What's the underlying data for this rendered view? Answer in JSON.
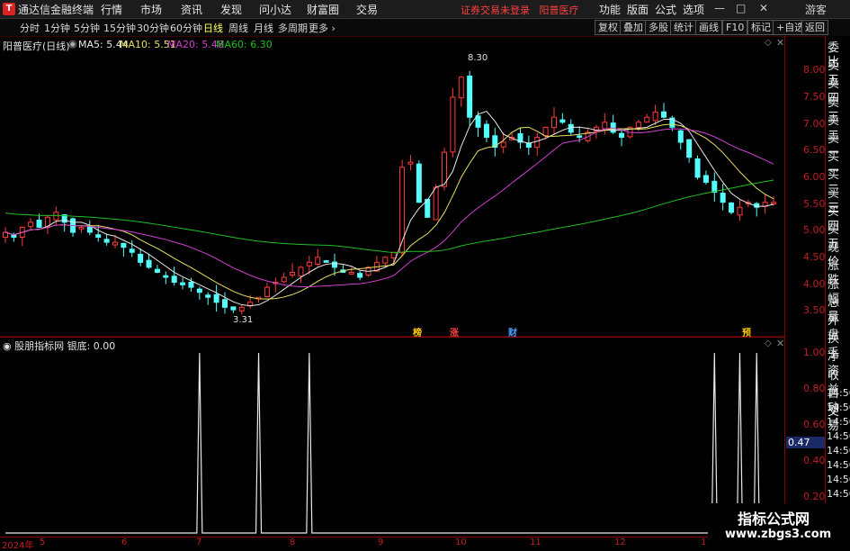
{
  "app": {
    "title": "通达信金融终端",
    "notice": "证券交易未登录",
    "stock_link": "阳普医疗"
  },
  "menu": [
    "行情",
    "市场",
    "资讯",
    "发现",
    "问小达",
    "财富圈",
    "交易"
  ],
  "right_menu": [
    "功能",
    "版面",
    "公式",
    "选项"
  ],
  "window_controls": {
    "min": "—",
    "max": "□",
    "close": "✕",
    "user": "游客"
  },
  "periods": [
    "分时",
    "1分钟",
    "5分钟",
    "15分钟",
    "30分钟",
    "60分钟",
    "日线",
    "周线",
    "月线",
    "多周期",
    "更多"
  ],
  "active_period": "日线",
  "toolbar_buttons": [
    "复权",
    "叠加",
    "多股",
    "统计",
    "画线",
    "F10",
    "标记",
    "+自选",
    "返回"
  ],
  "legend": {
    "name": "阳普医疗(日线)",
    "ma5": "MA5: 5.44",
    "ma10": "MA10: 5.51",
    "ma20": "MA20: 5.48",
    "ma60": "MA60: 6.30"
  },
  "colors": {
    "up": "#ff3b3b",
    "down": "#54ffff",
    "ma5": "#e8e8e8",
    "ma10": "#e8e060",
    "ma20": "#d040d0",
    "ma60": "#20c020",
    "axis": "#c02020"
  },
  "annotations": {
    "high": "8.30",
    "low": "3.31"
  },
  "event_tags": [
    "榜",
    "涨",
    "财",
    "预"
  ],
  "y_ticks": [
    "8.00",
    "7.50",
    "7.00",
    "6.50",
    "6.00",
    "5.50",
    "5.00",
    "4.50",
    "4.00",
    "3.50"
  ],
  "sub": {
    "legend": "股朋指标网  银底: 0.00",
    "y_ticks": [
      "1.00",
      "0.80",
      "0.60",
      "0.40",
      "0.20"
    ],
    "current": "0.47"
  },
  "right_panel": [
    "委比",
    "卖五",
    "卖四",
    "卖三",
    "卖二",
    "卖一",
    "买一",
    "买二",
    "买三",
    "买四",
    "买五",
    "现价",
    "涨跌",
    "涨幅",
    "总量",
    "外盘",
    "换手",
    "净资",
    "收益",
    "自动",
    "交易"
  ],
  "right_times": [
    "14:56",
    "14:56",
    "14:56",
    "14:56",
    "14:56",
    "14:56",
    "14:56",
    "14:56",
    "14:56"
  ],
  "x_ticks": [
    "2024年",
    "5",
    "6",
    "7",
    "8",
    "9",
    "10",
    "11",
    "12",
    "1"
  ],
  "watermark": {
    "line1": "指标公式网",
    "line2": "www.zbgs3.com"
  },
  "chart_data": {
    "type": "line",
    "title": "阳普医疗(日线)",
    "ylim": [
      3.1,
      8.5
    ],
    "close": [
      4.9,
      4.8,
      5.0,
      5.1,
      5.0,
      5.2,
      5.3,
      5.1,
      4.9,
      5.0,
      4.9,
      4.8,
      4.7,
      4.7,
      4.6,
      4.5,
      4.3,
      4.2,
      4.1,
      4.0,
      3.9,
      3.85,
      3.8,
      3.7,
      3.6,
      3.5,
      3.4,
      3.35,
      3.4,
      3.5,
      3.6,
      3.8,
      3.9,
      4.0,
      4.1,
      4.2,
      4.3,
      4.4,
      4.3,
      4.2,
      4.1,
      4.1,
      4.0,
      4.2,
      4.3,
      4.4,
      4.5,
      6.2,
      6.3,
      5.5,
      5.2,
      5.8,
      6.5,
      7.6,
      8.0,
      7.2,
      7.0,
      6.8,
      6.6,
      6.7,
      6.8,
      6.7,
      6.6,
      6.8,
      7.0,
      7.2,
      7.1,
      6.9,
      6.8,
      6.9,
      7.0,
      7.1,
      6.9,
      6.8,
      7.0,
      7.1,
      7.2,
      7.3,
      7.2,
      7.0,
      6.7,
      6.4,
      6.0,
      5.9,
      5.7,
      5.5,
      5.3,
      5.4,
      5.5,
      5.4,
      5.5,
      5.5
    ],
    "silver_bottom_signal_days": [
      23,
      30,
      36,
      84,
      87,
      89
    ],
    "ma60_end": 6.3
  }
}
